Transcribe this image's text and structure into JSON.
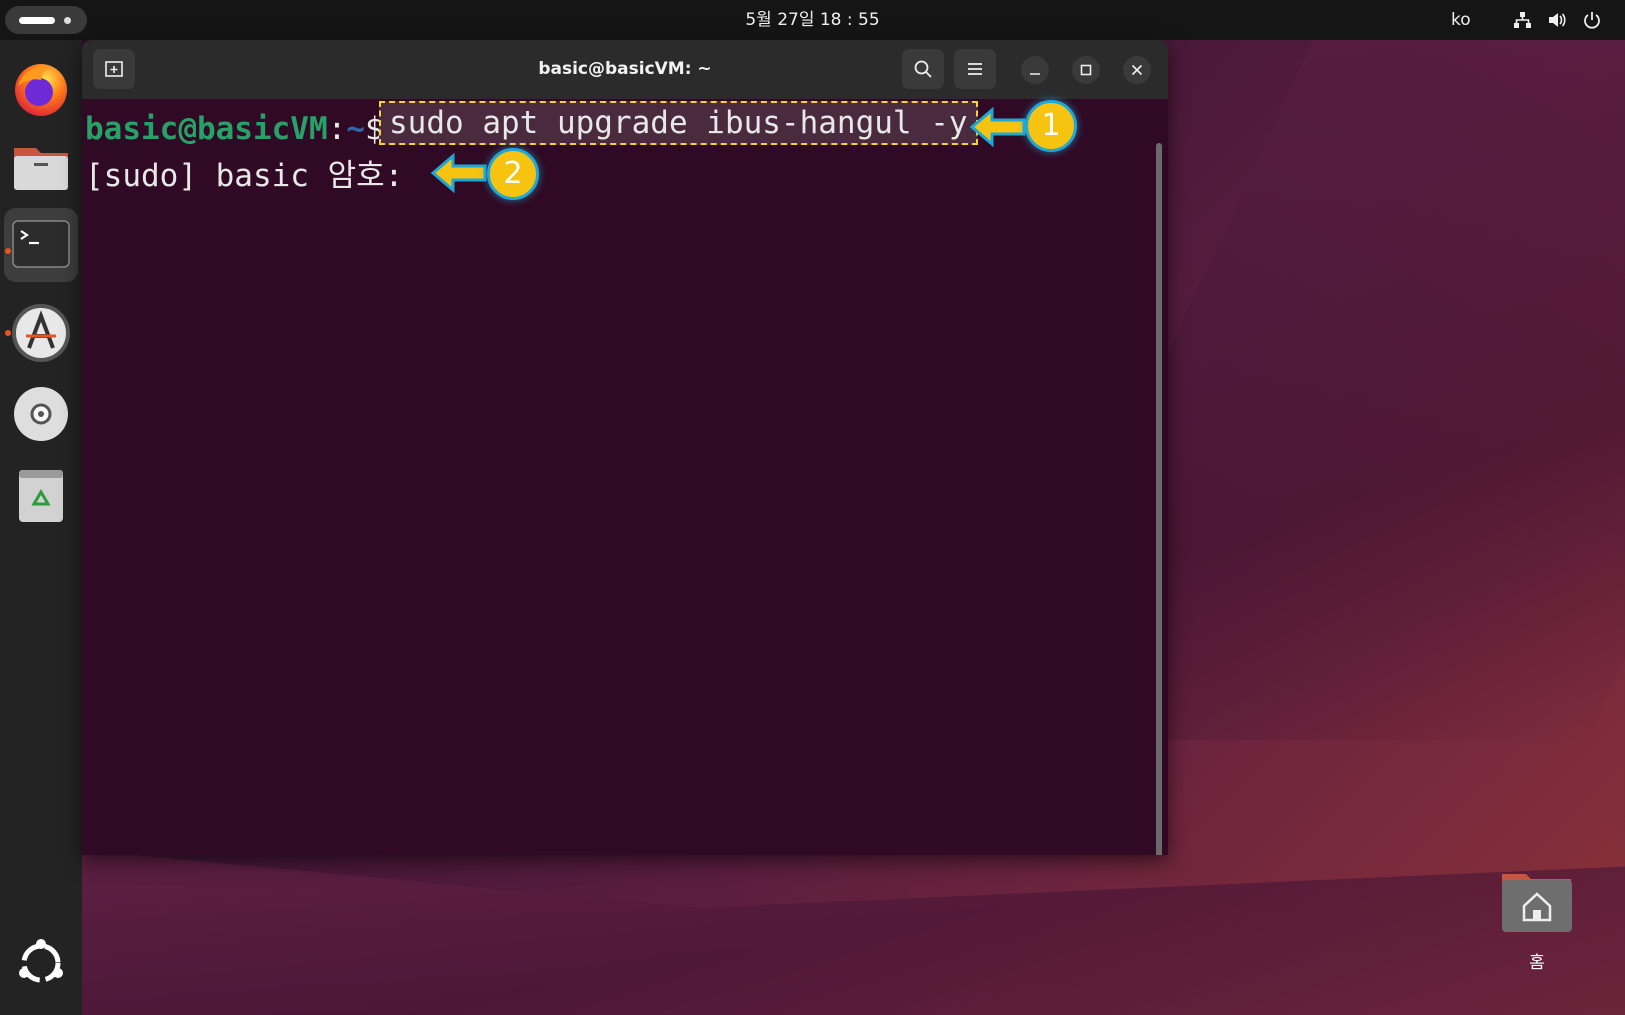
{
  "topbar": {
    "clock": "5월 27일  18 : 55",
    "language": "ko",
    "icons": [
      "network-icon",
      "volume-icon",
      "power-icon"
    ]
  },
  "dock": {
    "items": [
      "firefox-icon",
      "files-icon",
      "terminal-icon",
      "software-updater-icon",
      "dvd-icon",
      "trash-icon"
    ],
    "show_apps_icon": "ubuntu-apps-icon"
  },
  "terminal": {
    "title": "basic@basicVM: ~",
    "prompt_user": "basic@basicVM",
    "prompt_sep": ":",
    "prompt_path": "~",
    "prompt_sign": "$",
    "command": "sudo apt upgrade ibus-hangul -y",
    "sudo_prompt": "[sudo] basic 암호:"
  },
  "annotations": [
    {
      "number": "1"
    },
    {
      "number": "2"
    }
  ],
  "desktop": {
    "home_label": "홈"
  },
  "colors": {
    "terminal_bg": "#300a24",
    "prompt_user": "#26a269",
    "prompt_path": "#3465a4",
    "highlight_border": "#f6d231",
    "badge_fill": "#f6c311",
    "badge_ring": "#1ea8d8"
  }
}
